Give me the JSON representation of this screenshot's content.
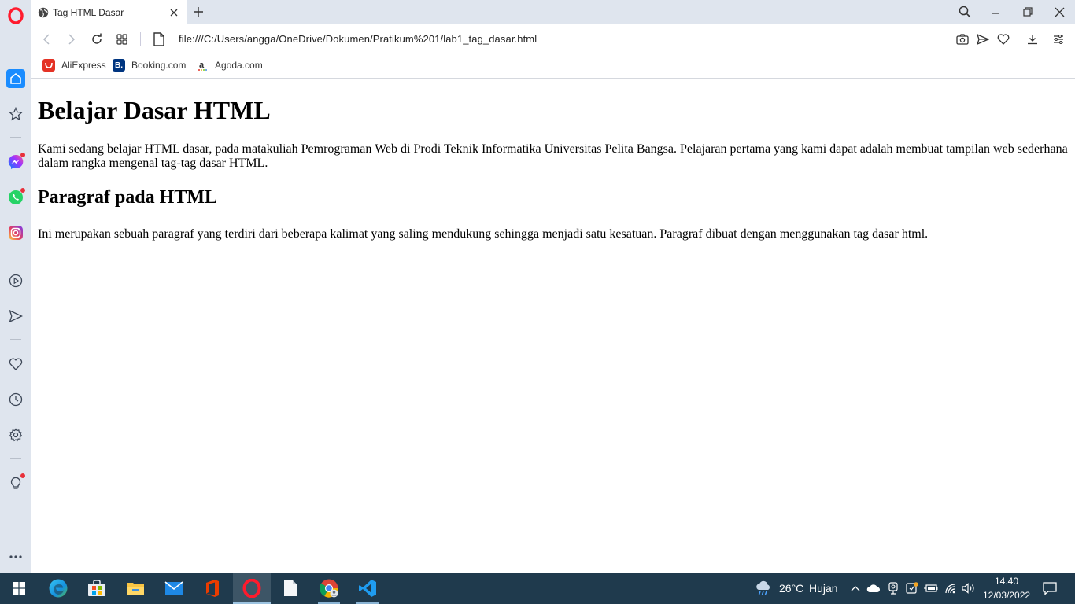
{
  "browser": {
    "tab": {
      "title": "Tag HTML Dasar"
    },
    "address_bar": {
      "url": "file:///C:/Users/angga/OneDrive/Dokumen/Pratikum%201/lab1_tag_dasar.html"
    },
    "bookmarks": [
      {
        "label": "AliExpress",
        "icon": "aliexpress-icon",
        "color": "#e43225"
      },
      {
        "label": "Booking.com",
        "icon": "booking-icon",
        "color": "#003580"
      },
      {
        "label": "Agoda.com",
        "icon": "agoda-icon",
        "color": "#ffffff"
      }
    ]
  },
  "page": {
    "heading1": "Belajar Dasar HTML",
    "paragraph1": "Kami sedang belajar HTML dasar, pada matakuliah Pemrograman Web di Prodi Teknik Informatika Universitas Pelita Bangsa. Pelajaran pertama yang kami dapat adalah membuat tampilan web sederhana dalam rangka mengenal tag-tag dasar HTML.",
    "heading2": "Paragraf pada HTML",
    "paragraph2": "Ini merupakan sebuah paragraf yang terdiri dari beberapa kalimat yang saling mendukung sehingga menjadi satu kesatuan. Paragraf dibuat dengan menggunakan tag dasar html."
  },
  "taskbar": {
    "weather": {
      "temp": "26°C",
      "condition": "Hujan"
    },
    "clock": {
      "time": "14.40",
      "date": "12/03/2022"
    }
  },
  "colors": {
    "opera_red": "#ff1b2d",
    "sidebar_bg": "#dfe5ee",
    "taskbar_bg": "#1f3a4d",
    "home_accent": "#1a8cff"
  }
}
